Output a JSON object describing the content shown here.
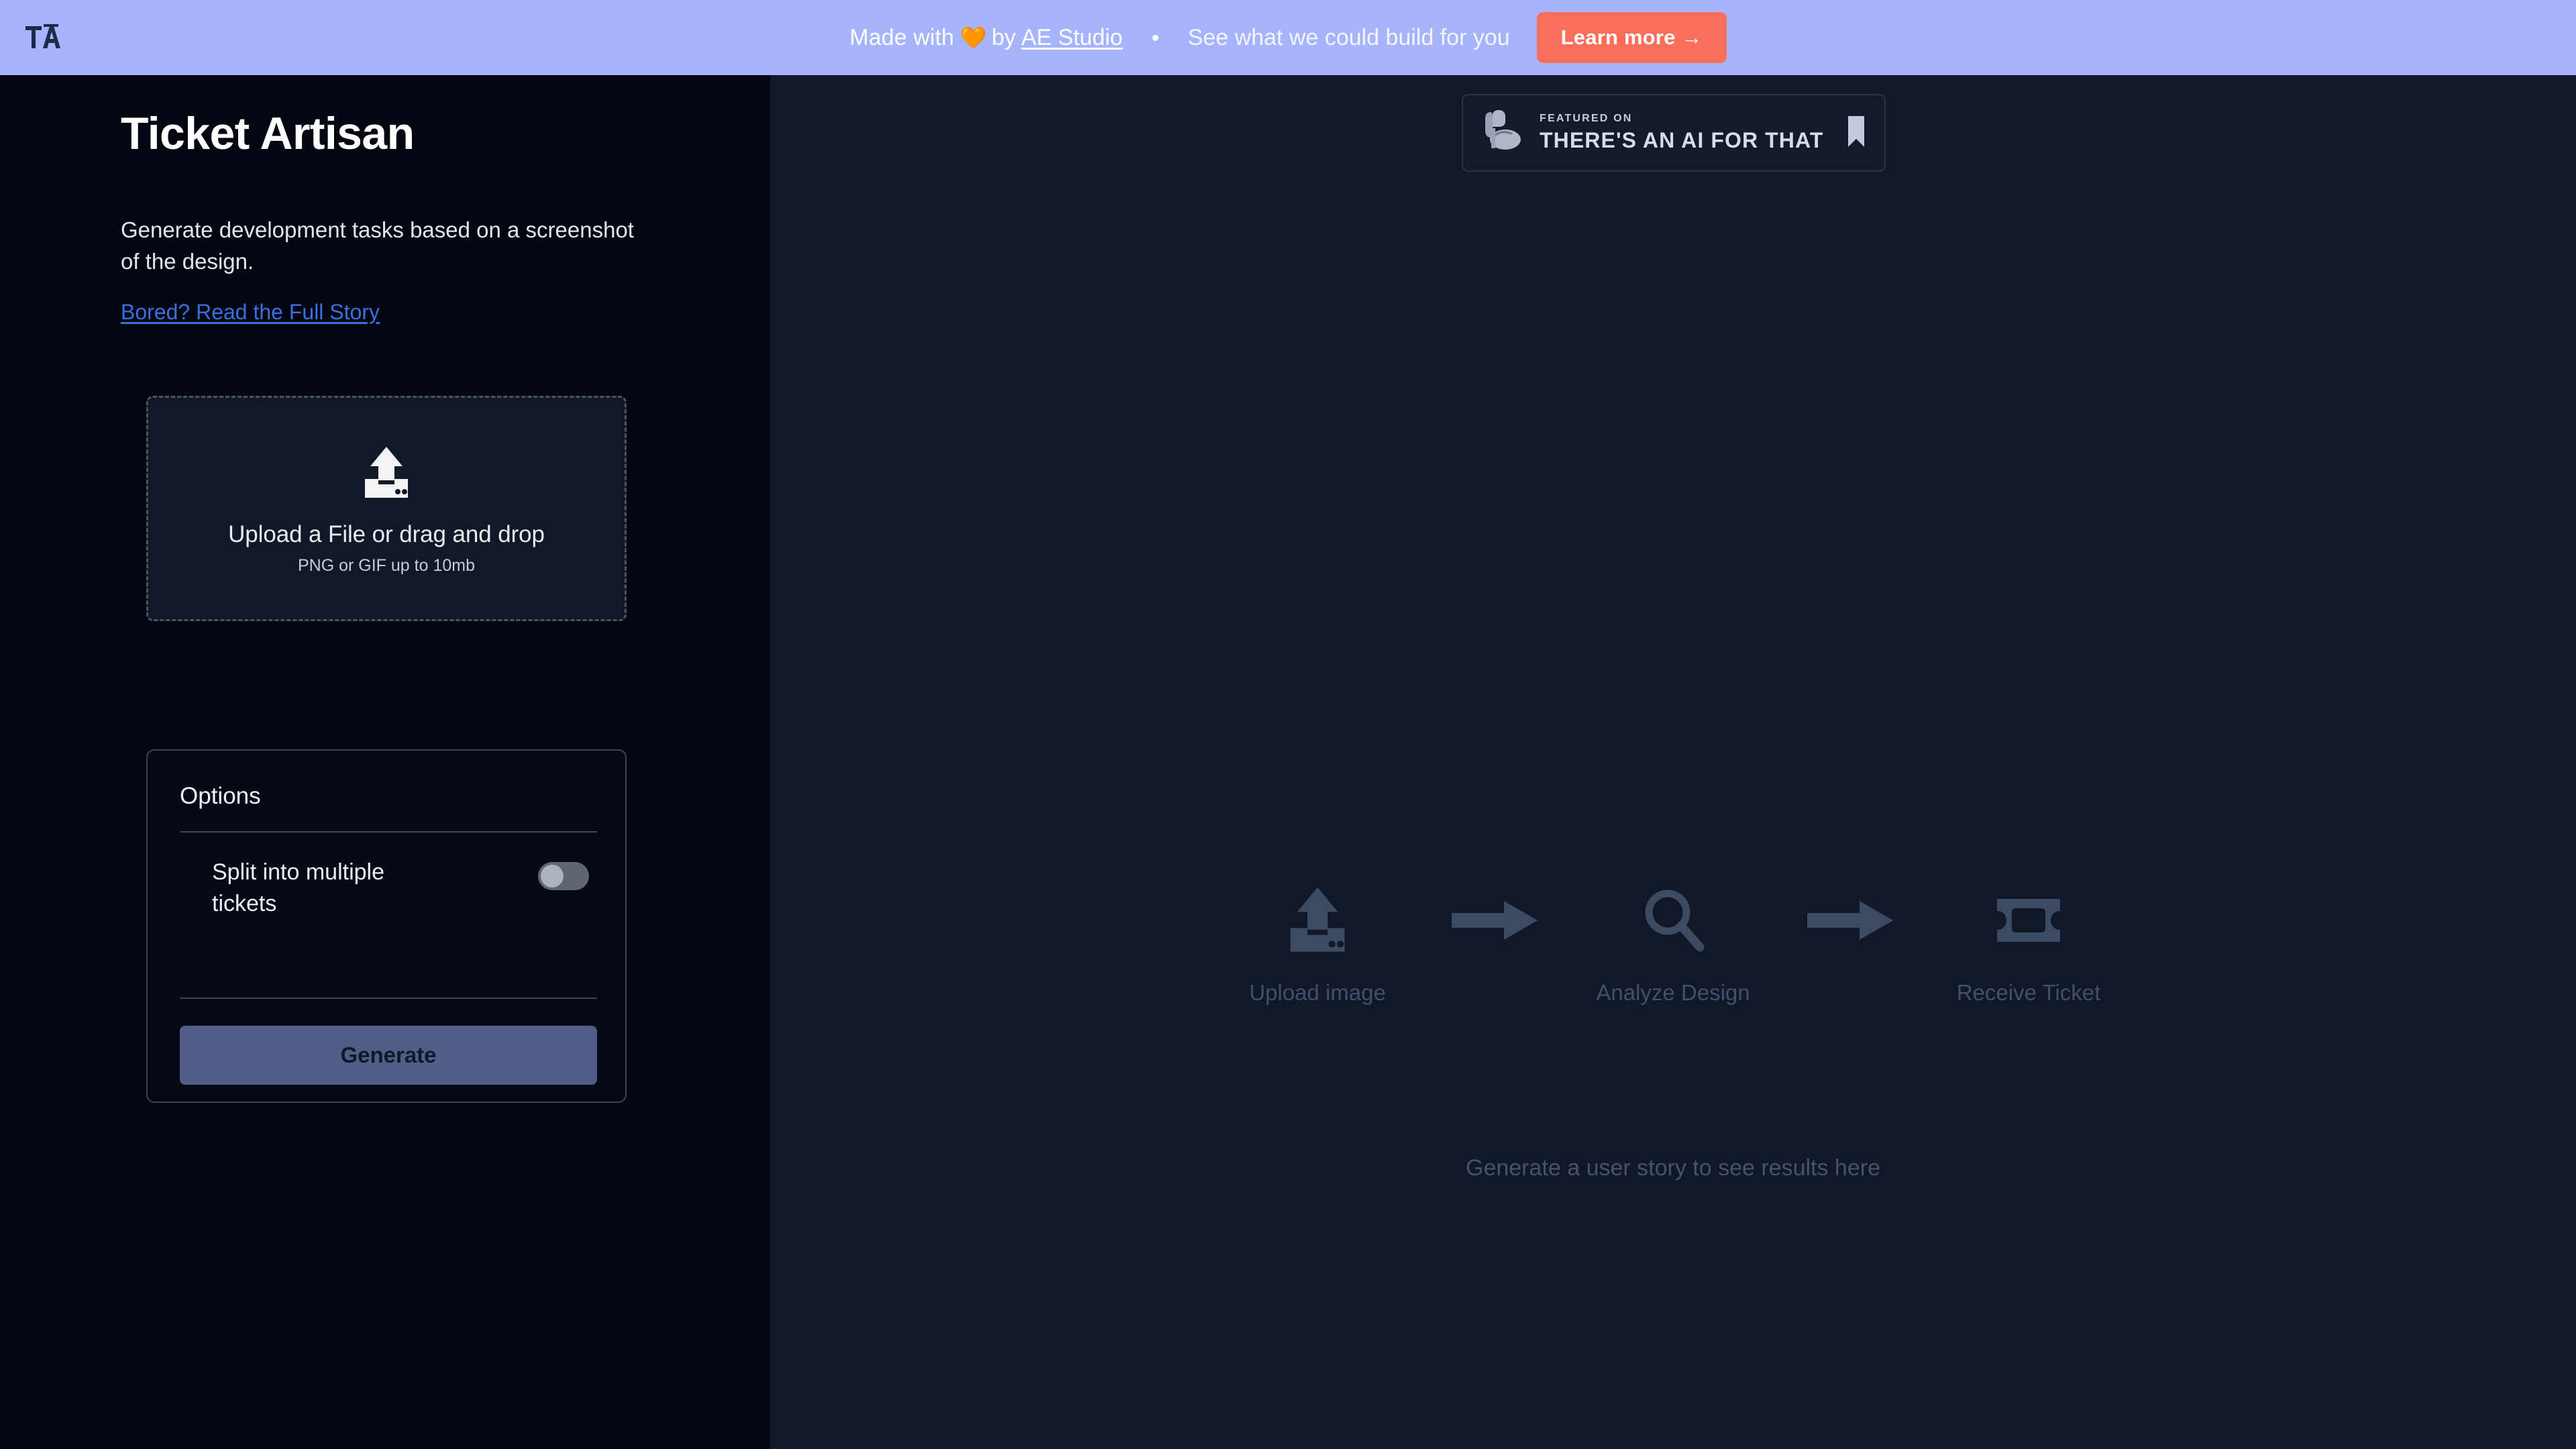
{
  "promo": {
    "logo_text": "TA",
    "logo_icon": "ta-monogram-icon",
    "made_with_prefix": "Made with",
    "heart_icon": "orange-heart-icon",
    "made_with_by": "by",
    "studio_link": "AE Studio",
    "separator_icon": "dot-separator-icon",
    "tagline": "See what we could build for you",
    "learn_more_label": "Learn more →",
    "bg_color": "#a5b4fc",
    "button_color": "#fa6e5a"
  },
  "sidebar": {
    "title": "Ticket Artisan",
    "subtitle": "Generate development tasks based on a screenshot of the design.",
    "story_link": "Bored? Read the Full Story",
    "story_link_color": "#3b6fe0",
    "dropzone": {
      "icon": "file-upload-icon",
      "title": "Upload a File or drag and drop",
      "hint": "PNG or GIF up to 10mb"
    },
    "options": {
      "heading": "Options",
      "items": [
        {
          "label": "Split into multiple tickets",
          "toggle_icon": "toggle-switch-icon",
          "toggle_state": "off"
        }
      ],
      "generate_label": "Generate",
      "generate_color": "#525d88"
    }
  },
  "main": {
    "badge": {
      "bicep_icon": "flexed-bicep-icon",
      "featured_label": "FEATURED ON",
      "site_name": "THERE'S AN AI FOR THAT",
      "bookmark_icon": "bookmark-icon"
    },
    "steps": [
      {
        "label": "Upload image",
        "icon": "file-upload-icon"
      },
      {
        "label": "Analyze Design",
        "icon": "magnifying-glass-icon"
      },
      {
        "label": "Receive Ticket",
        "icon": "ticket-icon"
      }
    ],
    "arrow_icon": "arrow-right-icon",
    "empty_message": "Generate a user story to see results here"
  }
}
